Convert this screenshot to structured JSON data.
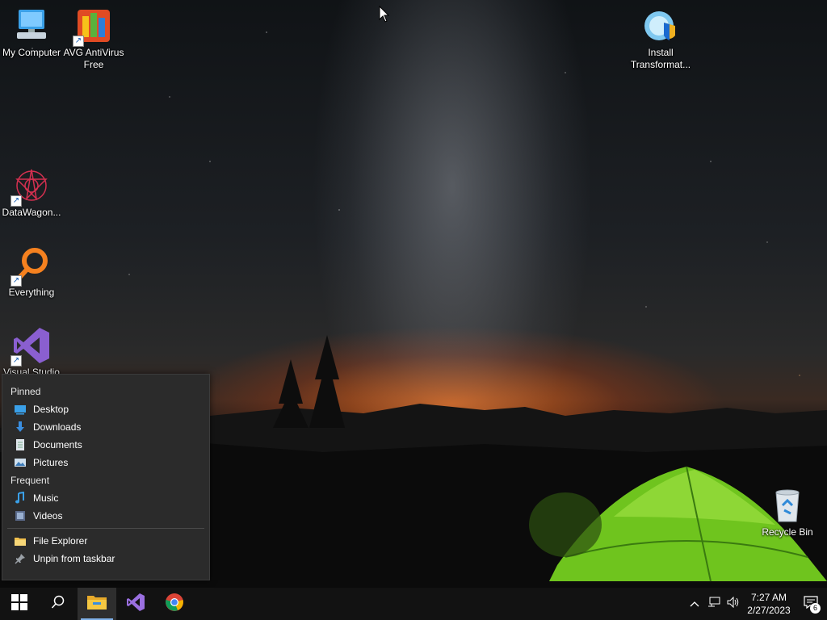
{
  "desktop": {
    "icons": [
      {
        "label": "My Computer"
      },
      {
        "label": "AVG AntiVirus Free"
      },
      {
        "label": "Install Transformat..."
      },
      {
        "label": "DataWagon..."
      },
      {
        "label": "Everything"
      },
      {
        "label": "Visual Studio"
      },
      {
        "label": "Recycle Bin"
      }
    ]
  },
  "jumplist": {
    "pinned_header": "Pinned",
    "pinned": [
      {
        "label": "Desktop",
        "icon": "desktop-folder-icon"
      },
      {
        "label": "Downloads",
        "icon": "downloads-folder-icon"
      },
      {
        "label": "Documents",
        "icon": "documents-folder-icon"
      },
      {
        "label": "Pictures",
        "icon": "pictures-folder-icon"
      }
    ],
    "frequent_header": "Frequent",
    "frequent": [
      {
        "label": "Music",
        "icon": "music-folder-icon"
      },
      {
        "label": "Videos",
        "icon": "videos-folder-icon"
      }
    ],
    "tasks": [
      {
        "label": "File Explorer",
        "icon": "file-explorer-icon"
      },
      {
        "label": "Unpin from taskbar",
        "icon": "pin-icon"
      }
    ]
  },
  "taskbar": {
    "apps": [
      "start",
      "search",
      "file-explorer",
      "visual-studio",
      "chrome"
    ],
    "clock_time": "7:27 AM",
    "clock_date": "2/27/2023",
    "notification_count": "6"
  },
  "colors": {
    "taskbar": "#121212",
    "jumplist_bg": "#2b2b2b",
    "accent": "#7fb0e8"
  }
}
